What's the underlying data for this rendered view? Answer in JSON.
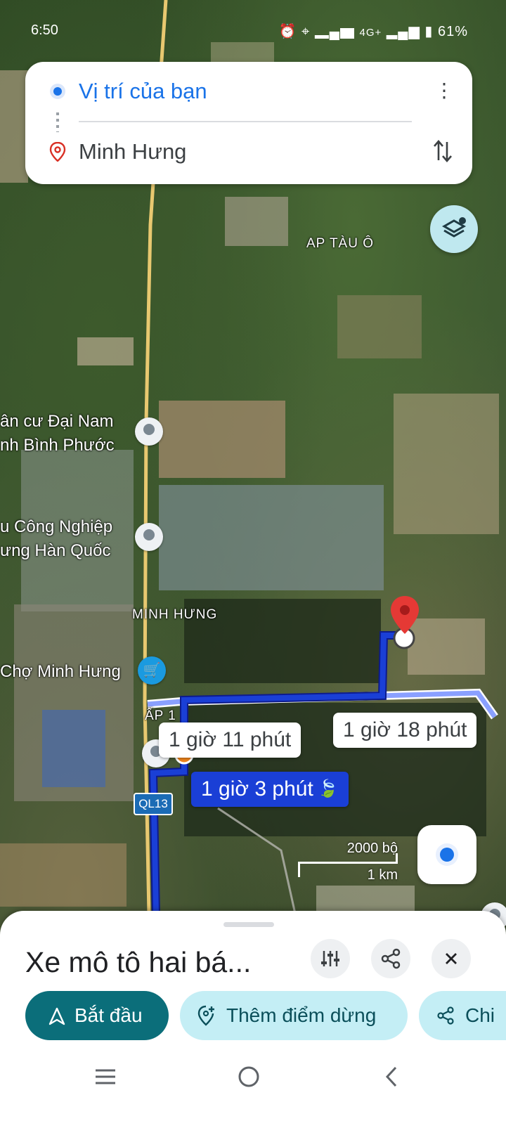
{
  "status_bar": {
    "time": "6:50",
    "network": "4G+",
    "battery": "61%"
  },
  "directions": {
    "origin": "Vị trí của bạn",
    "destination": "Minh Hưng"
  },
  "map": {
    "labels": {
      "ap_tau_o": "AP TÀU Ô",
      "dai_nam_1": "ân cư Đại Nam",
      "dai_nam_2": "nh Bình Phước",
      "kcn_1": "u Công Nghiệp",
      "kcn_2": "ưng Hàn Quốc",
      "minh_hung": "MINH HƯNG",
      "cho": "Chợ Minh Hưng",
      "ap1": "ẤP 1"
    },
    "road_shield": "QL13",
    "route_times": {
      "primary": "1 giờ 3 phút",
      "alt_1": "1 giờ 11 phút",
      "alt_2": "1 giờ 18 phút"
    },
    "scale": {
      "imperial": "2000 bộ",
      "metric": "1 km"
    },
    "colors": {
      "route_primary": "#1a3fd6",
      "route_alt": "#8aa0ff"
    }
  },
  "sheet": {
    "title": "Xe mô tô hai bá...",
    "start_label": "Bắt đầu",
    "add_stop_label": "Thêm điểm dừng",
    "share_label": "Chi"
  }
}
